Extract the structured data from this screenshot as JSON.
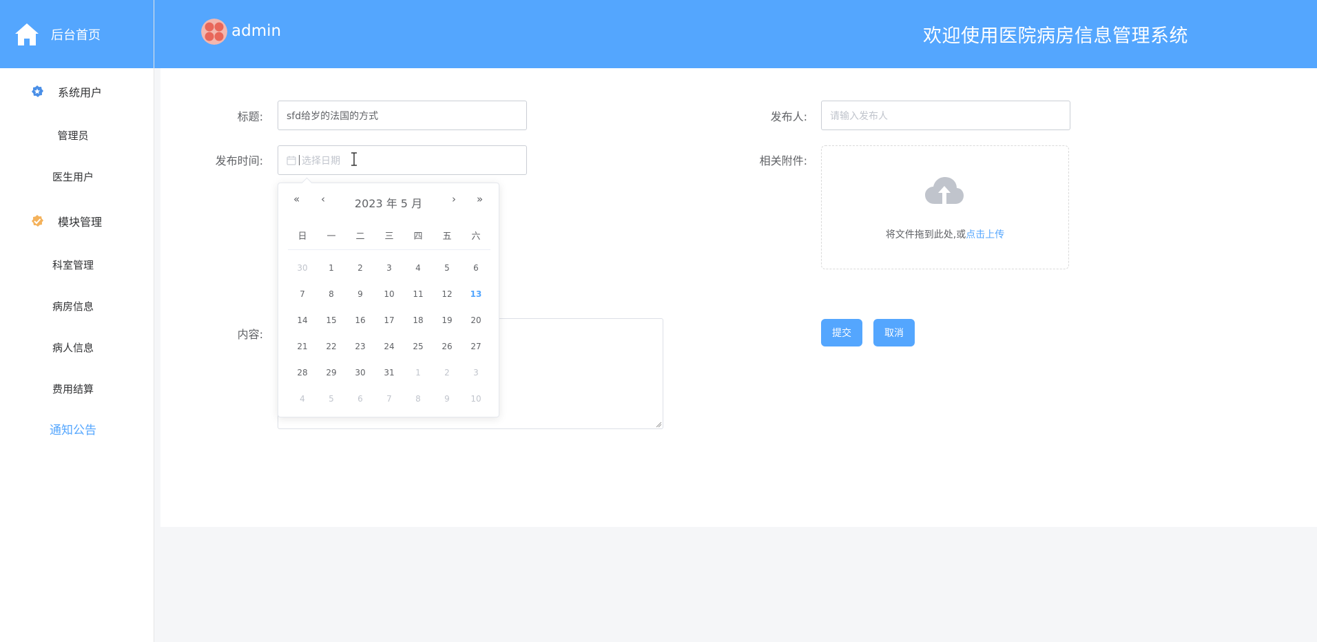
{
  "sidebar": {
    "home_label": "后台首页",
    "groups": [
      {
        "label": "系统用户",
        "icon": "star-badge-icon",
        "color": "#4a8fe7",
        "items": [
          "管理员",
          "医生用户"
        ]
      },
      {
        "label": "模块管理",
        "icon": "gear-badge-icon",
        "color": "#f4b25b",
        "items": [
          "科室管理",
          "病房信息",
          "病人信息",
          "费用结算"
        ]
      }
    ],
    "active_item": "通知公告"
  },
  "header": {
    "user": "admin",
    "system_title": "欢迎使用医院病房信息管理系统"
  },
  "form": {
    "title_label": "标题:",
    "title_value": "sfd给岁的法国的方式",
    "publisher_label": "发布人:",
    "publisher_placeholder": "请输入发布人",
    "time_label": "发布时间:",
    "time_placeholder": "选择日期",
    "attachment_label": "相关附件:",
    "upload_text": "将文件拖到此处,或",
    "upload_link": "点击上传",
    "content_label": "内容:",
    "submit_label": "提交",
    "cancel_label": "取消"
  },
  "datepicker": {
    "title": "2023 年  5 月",
    "prev_year": "«",
    "prev_month": "‹",
    "next_month": "›",
    "next_year": "»",
    "weekdays": [
      "日",
      "一",
      "二",
      "三",
      "四",
      "五",
      "六"
    ],
    "weeks": [
      [
        {
          "d": "30",
          "o": true
        },
        {
          "d": "1"
        },
        {
          "d": "2"
        },
        {
          "d": "3"
        },
        {
          "d": "4"
        },
        {
          "d": "5"
        },
        {
          "d": "6"
        }
      ],
      [
        {
          "d": "7"
        },
        {
          "d": "8"
        },
        {
          "d": "9"
        },
        {
          "d": "10"
        },
        {
          "d": "11"
        },
        {
          "d": "12"
        },
        {
          "d": "13",
          "t": true
        }
      ],
      [
        {
          "d": "14"
        },
        {
          "d": "15"
        },
        {
          "d": "16"
        },
        {
          "d": "17"
        },
        {
          "d": "18"
        },
        {
          "d": "19"
        },
        {
          "d": "20"
        }
      ],
      [
        {
          "d": "21"
        },
        {
          "d": "22"
        },
        {
          "d": "23"
        },
        {
          "d": "24"
        },
        {
          "d": "25"
        },
        {
          "d": "26"
        },
        {
          "d": "27"
        }
      ],
      [
        {
          "d": "28"
        },
        {
          "d": "29"
        },
        {
          "d": "30"
        },
        {
          "d": "31"
        },
        {
          "d": "1",
          "o": true
        },
        {
          "d": "2",
          "o": true
        },
        {
          "d": "3",
          "o": true
        }
      ],
      [
        {
          "d": "4",
          "o": true
        },
        {
          "d": "5",
          "o": true
        },
        {
          "d": "6",
          "o": true
        },
        {
          "d": "7",
          "o": true
        },
        {
          "d": "8",
          "o": true
        },
        {
          "d": "9",
          "o": true
        },
        {
          "d": "10",
          "o": true
        }
      ]
    ]
  },
  "colors": {
    "primary": "#54a6fe",
    "today": "#54a6fe"
  }
}
